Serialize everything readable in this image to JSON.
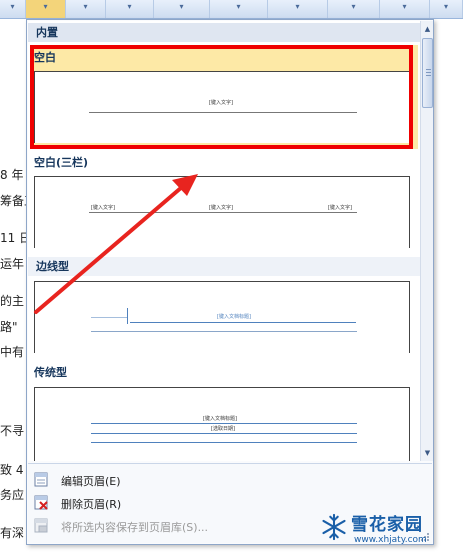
{
  "document_lines": [
    "8 年",
    "筹备工",
    "11 日",
    "运年",
    "的主",
    "路\"",
    "中有",
    "不寻",
    "致 4",
    "务应",
    "有深"
  ],
  "dropdown": {
    "section_title": "内置",
    "items": [
      {
        "label": "空白",
        "placeholders": [
          "[键入文字]"
        ]
      },
      {
        "label": "空白(三栏)",
        "placeholders": [
          "[键入文字]",
          "[键入文字]",
          "[键入文字]"
        ]
      },
      {
        "label": "边线型",
        "placeholders": [
          "[键入文档标题]"
        ]
      },
      {
        "label": "传统型",
        "placeholders": [
          "[键入文档标题]",
          "[选取日期]"
        ]
      }
    ],
    "commands": [
      {
        "label": "编辑页眉(E)",
        "icon": "edit-header-icon",
        "enabled": true
      },
      {
        "label": "删除页眉(R)",
        "icon": "delete-header-icon",
        "enabled": true
      },
      {
        "label": "将所选内容保存到页眉库(S)...",
        "icon": "save-to-gallery-icon",
        "enabled": false
      }
    ]
  },
  "watermark": {
    "title": "雪花家园",
    "url": "www.xhjaty.com"
  },
  "colors": {
    "highlight_red": "#ef0000",
    "selected_bg": "#fde9a6",
    "header_text": "#16365c",
    "arrow_red": "#e8241f"
  }
}
